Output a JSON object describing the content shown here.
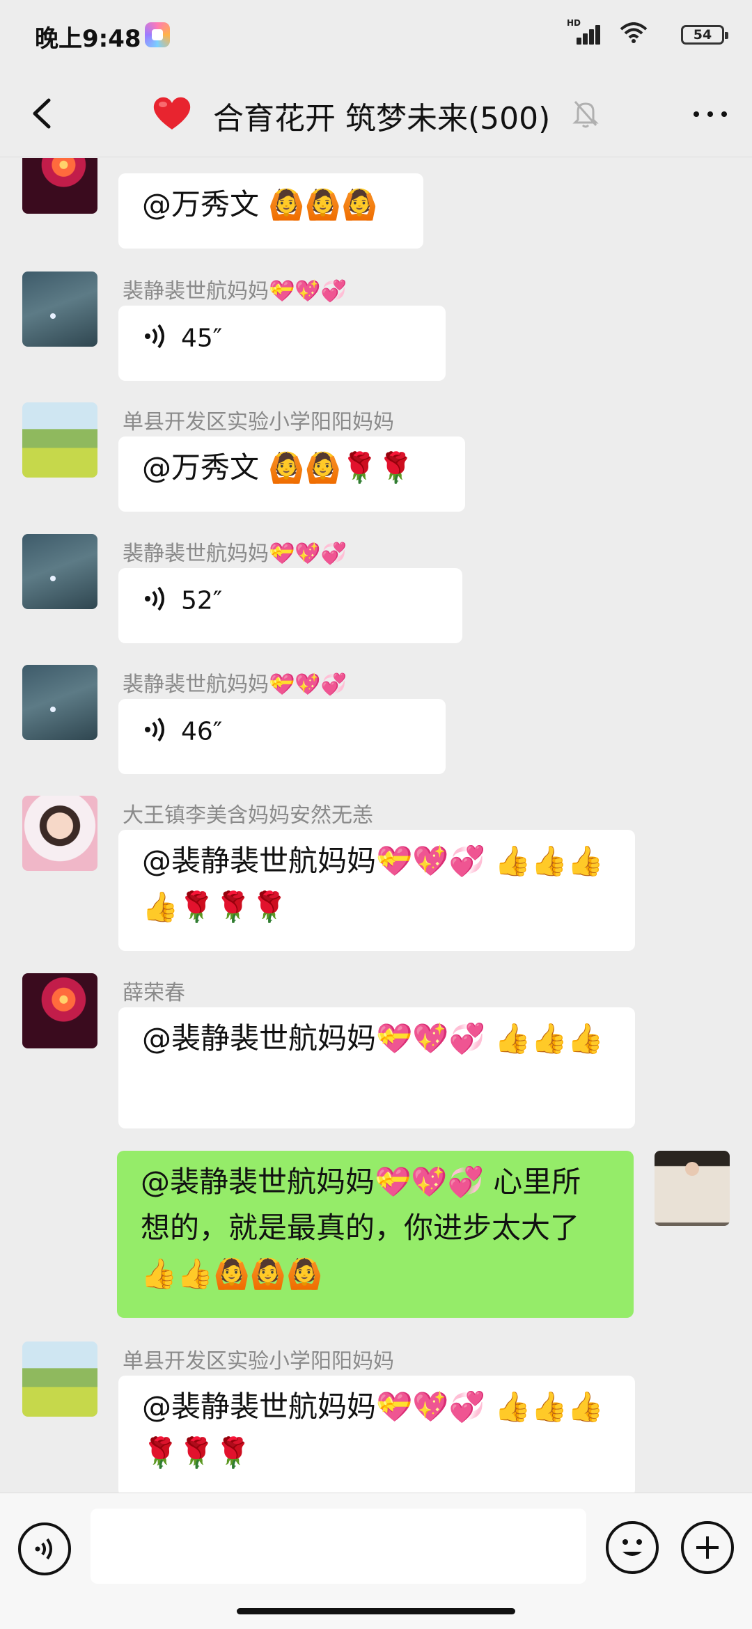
{
  "status_bar": {
    "time": "晚上9:48",
    "network": "HD",
    "battery": "54"
  },
  "header": {
    "heart_emoji": "❤️",
    "title": "合育花开 筑梦未来(500)",
    "icons": {
      "back": "chevron-left-icon",
      "mute": "bell-slash-icon",
      "more": "more-dots-icon"
    }
  },
  "messages": [
    {
      "sender": "",
      "avatar": "firework",
      "type": "text",
      "text": "@万秀文 🙆🙆🙆"
    },
    {
      "sender": "裴静裴世航妈妈💝💖💞",
      "avatar": "night",
      "type": "voice",
      "duration": "45″"
    },
    {
      "sender": "单县开发区实验小学阳阳妈妈",
      "avatar": "field",
      "type": "text",
      "text": "@万秀文 🙆🙆🌹🌹"
    },
    {
      "sender": "裴静裴世航妈妈💝💖💞",
      "avatar": "night",
      "type": "voice",
      "duration": "52″"
    },
    {
      "sender": "裴静裴世航妈妈💝💖💞",
      "avatar": "night",
      "type": "voice",
      "duration": "46″"
    },
    {
      "sender": "大王镇李美含妈妈安然无恙",
      "avatar": "girl",
      "type": "text",
      "text": "@裴静裴世航妈妈💝💖💞 👍👍👍👍🌹🌹🌹"
    },
    {
      "sender": "薛荣春",
      "avatar": "firework",
      "type": "text",
      "text": "@裴静裴世航妈妈💝💖💞 👍👍👍"
    },
    {
      "sender": "",
      "avatar": "self",
      "type": "text",
      "mine": true,
      "text": "@裴静裴世航妈妈💝💖💞 心里所想的，就是最真的，你进步太大了👍👍🙆🙆🙆"
    },
    {
      "sender": "单县开发区实验小学阳阳妈妈",
      "avatar": "field",
      "type": "text",
      "text": "@裴静裴世航妈妈💝💖💞 👍👍👍🌹🌹🌹"
    }
  ],
  "input_bar": {
    "placeholder": "",
    "icons": {
      "voice": "voice-input-icon",
      "emoji": "emoji-face-icon",
      "add": "plus-circle-icon"
    }
  }
}
